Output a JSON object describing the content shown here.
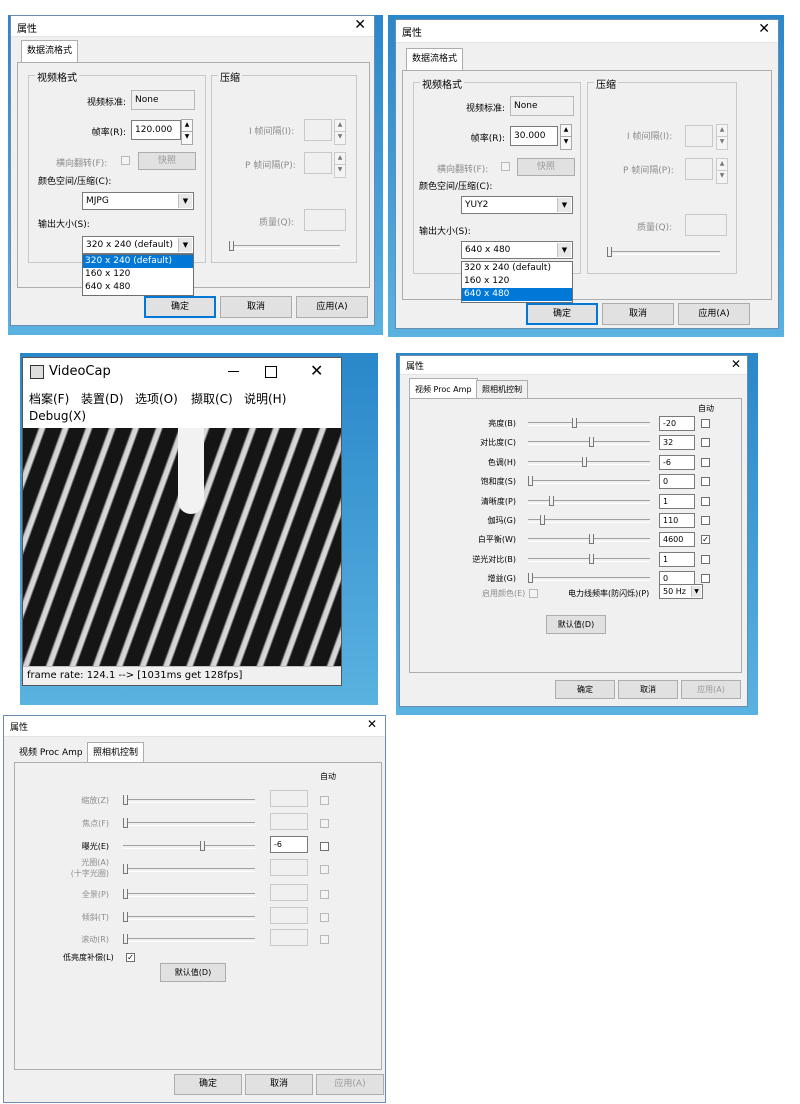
{
  "dlg1": {
    "title": "属性",
    "tab": "数据流格式",
    "video_group": "视频格式",
    "compress_group": "压缩",
    "standard_label": "视频标准:",
    "standard_value": "None",
    "rate_label": "帧率(R):",
    "rate_value": "120.000",
    "flip_label": "横向翻转(F):",
    "snapshot": "快照",
    "color_label": "颜色空间/压缩(C):",
    "color_value": "MJPG",
    "size_label": "输出大小(S):",
    "size_value": "320 x 240  (default)",
    "size_options": [
      "320 x 240  (default)",
      "160 x 120",
      "640 x 480"
    ],
    "i_interval": "I 帧间隔(I):",
    "p_interval": "P 帧间隔(P):",
    "quality": "质量(Q):",
    "ok": "确定",
    "cancel": "取消",
    "apply": "应用(A)"
  },
  "dlg2": {
    "title": "属性",
    "tab": "数据流格式",
    "video_group": "视频格式",
    "compress_group": "压缩",
    "standard_label": "视频标准:",
    "standard_value": "None",
    "rate_label": "帧率(R):",
    "rate_value": "30.000",
    "flip_label": "横向翻转(F):",
    "snapshot": "快照",
    "color_label": "颜色空间/压缩(C):",
    "color_value": "YUY2",
    "size_label": "输出大小(S):",
    "size_value": "640 x 480",
    "size_options": [
      "320 x 240  (default)",
      "160 x 120",
      "640 x 480"
    ],
    "i_interval": "I 帧间隔(I):",
    "p_interval": "P 帧间隔(P):",
    "quality": "质量(Q):",
    "ok": "确定",
    "cancel": "取消",
    "apply": "应用(A)"
  },
  "videocap": {
    "title": "VideoCap",
    "menu": [
      "档案(F)",
      "装置(D)",
      "选项(O)",
      "撷取(C)",
      "说明(H)",
      "Debug(X)"
    ],
    "status": "frame rate: 124.1 --> [1031ms get 128fps]"
  },
  "procamp": {
    "title": "属性",
    "tab1": "视频 Proc Amp",
    "tab2": "照相机控制",
    "auto": "自动",
    "rows": [
      {
        "label": "亮度(B)",
        "value": "-20",
        "level": 0.36,
        "checked": false
      },
      {
        "label": "对比度(C)",
        "value": "32",
        "level": 0.5,
        "checked": false
      },
      {
        "label": "色调(H)",
        "value": "-6",
        "level": 0.44,
        "checked": false
      },
      {
        "label": "饱和度(S)",
        "value": "0",
        "level": 0.0,
        "checked": false
      },
      {
        "label": "清晰度(P)",
        "value": "1",
        "level": 0.17,
        "checked": false
      },
      {
        "label": "伽玛(G)",
        "value": "110",
        "level": 0.1,
        "checked": false
      },
      {
        "label": "白平衡(W)",
        "value": "4600",
        "level": 0.5,
        "checked": true
      },
      {
        "label": "逆光对比(B)",
        "value": "1",
        "level": 0.5,
        "checked": false
      },
      {
        "label": "增益(G)",
        "value": "0",
        "level": 0.0,
        "checked": false
      }
    ],
    "enable_color": "启用颜色(E)",
    "powerline_label": "电力线频率(防闪烁)(P)",
    "powerline_value": "50 Hz",
    "default_btn": "默认值(D)",
    "ok": "确定",
    "cancel": "取消",
    "apply": "应用(A)"
  },
  "camctrl": {
    "title": "属性",
    "tab1": "视频 Proc Amp",
    "tab2": "照相机控制",
    "auto": "自动",
    "rows": [
      {
        "label": "缩放(Z)",
        "value": "",
        "level": 0.0,
        "enabled": false
      },
      {
        "label": "焦点(F)",
        "value": "",
        "level": 0.0,
        "enabled": false
      },
      {
        "label": "曝光(E)",
        "value": "-6",
        "level": 0.58,
        "enabled": true
      },
      {
        "label": "光圈(A)",
        "label2": "(十字光圈)",
        "value": "",
        "level": 0.0,
        "enabled": false
      },
      {
        "label": "全景(P)",
        "value": "",
        "level": 0.0,
        "enabled": false
      },
      {
        "label": "倾斜(T)",
        "value": "",
        "level": 0.0,
        "enabled": false
      },
      {
        "label": "滚动(R)",
        "value": "",
        "level": 0.0,
        "enabled": false
      }
    ],
    "lowlight": "低亮度补偿(L)",
    "default_btn": "默认值(D)",
    "ok": "确定",
    "cancel": "取消",
    "apply": "应用(A)"
  }
}
